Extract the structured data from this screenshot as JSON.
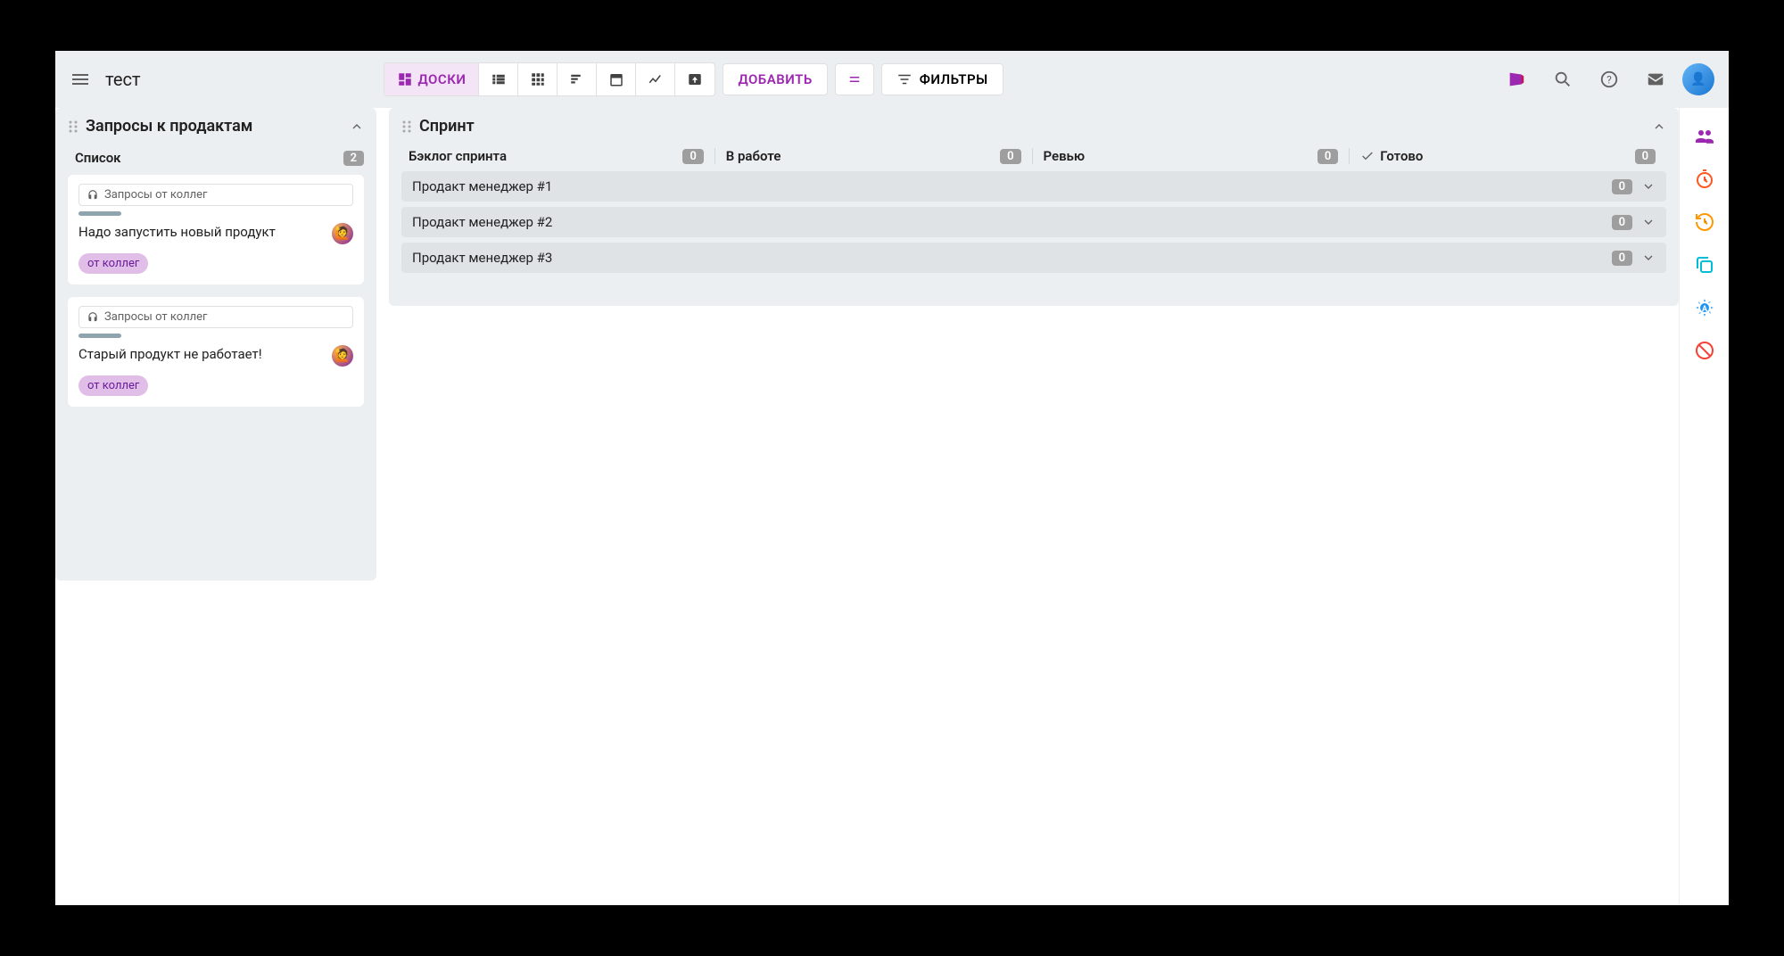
{
  "app": {
    "title": "тест"
  },
  "toolbar": {
    "boards_label": "ДОСКИ",
    "add_label": "ДОБАВИТЬ",
    "filters_label": "ФИЛЬТРЫ"
  },
  "leftBoard": {
    "title": "Запросы к продактам",
    "listLabel": "Список",
    "count": "2",
    "cards": [
      {
        "source": "Запросы от коллег",
        "title": "Надо запустить новый продукт",
        "tag": "от коллег"
      },
      {
        "source": "Запросы от коллег",
        "title": "Старый продукт не работает!",
        "tag": "от коллег"
      }
    ]
  },
  "rightBoard": {
    "title": "Спринт",
    "columns": [
      {
        "name": "Бэклог спринта",
        "count": "0"
      },
      {
        "name": "В работе",
        "count": "0"
      },
      {
        "name": "Ревью",
        "count": "0"
      },
      {
        "name": "Готово",
        "count": "0",
        "check": true
      }
    ],
    "rows": [
      {
        "name": "Продакт менеджер #1",
        "count": "0"
      },
      {
        "name": "Продакт менеджер #2",
        "count": "0"
      },
      {
        "name": "Продакт менеджер #3",
        "count": "0"
      }
    ]
  }
}
